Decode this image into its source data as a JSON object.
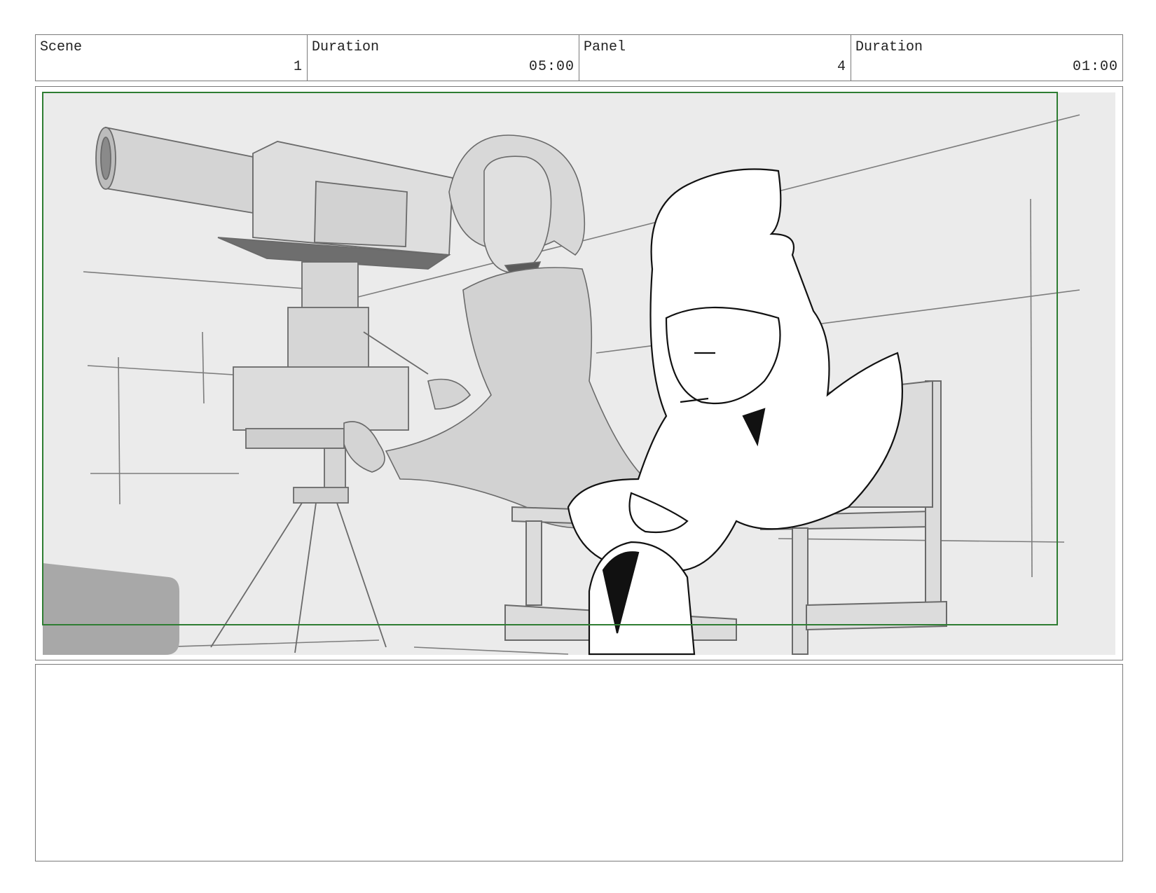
{
  "header": {
    "cells": [
      {
        "label": "Scene",
        "value": "1"
      },
      {
        "label": "Duration",
        "value": "05:00"
      },
      {
        "label": "Panel",
        "value": "4"
      },
      {
        "label": "Duration",
        "value": "01:00"
      }
    ]
  },
  "panel": {
    "safe_frame_color": "#2e7d32",
    "sketch_background": "#ebebeb",
    "notes_text": ""
  }
}
